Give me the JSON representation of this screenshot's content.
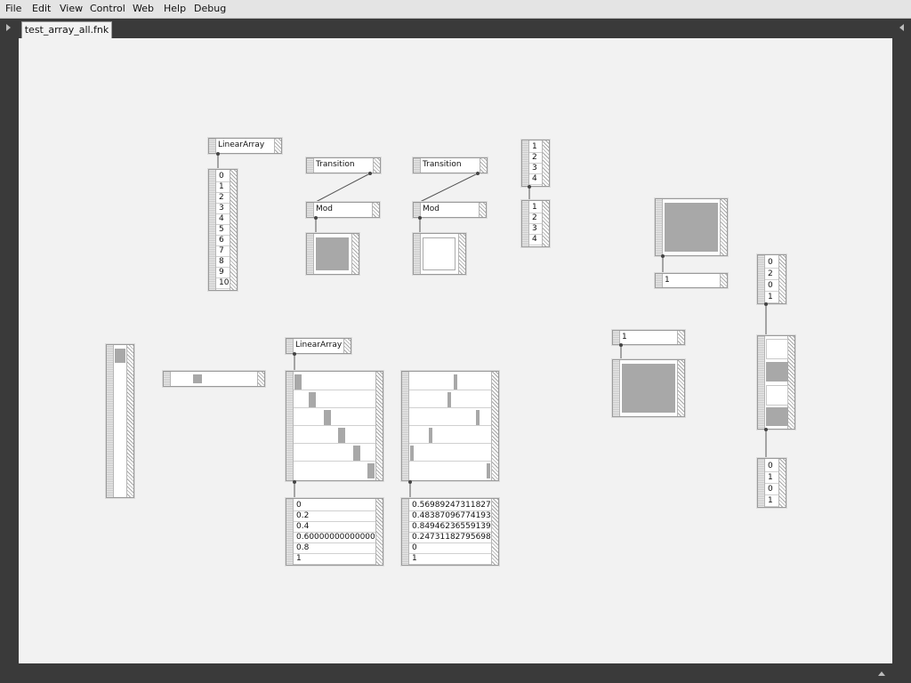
{
  "menu": [
    "File",
    "Edit",
    "View",
    "Control",
    "Web",
    "Help",
    "Debug"
  ],
  "tab": {
    "title": "test_array_all.fnk"
  },
  "nodes": {
    "linear_array_1": "LinearArray",
    "array_list_1": [
      "0",
      "1",
      "2",
      "3",
      "4",
      "5",
      "6",
      "7",
      "8",
      "9",
      "10"
    ],
    "transition_1": "Transition",
    "mod_1": "Mod",
    "transition_2": "Transition",
    "mod_2": "Mod",
    "small_list_a": [
      "1",
      "2",
      "3",
      "4"
    ],
    "small_list_b": [
      "1",
      "2",
      "3",
      "4"
    ],
    "value_1": "1",
    "list_right_top": [
      "0",
      "2",
      "0",
      "1"
    ],
    "list_right_bottom": [
      "0",
      "1",
      "0",
      "1"
    ],
    "value_2": "1",
    "linear_array_2": "LinearArray",
    "values_left": [
      "0",
      "0.2",
      "0.4",
      "0.6000000000000001",
      "0.8",
      "1"
    ],
    "values_right": [
      "0.5698924731182796",
      "0.4838709677419355",
      "0.8494623655913979",
      "0.24731182795698925",
      "0",
      "1"
    ]
  },
  "colors": {
    "canvas": "#f2f2f2",
    "chrome": "#3a3a3a",
    "fill": "#a8a8a8"
  }
}
